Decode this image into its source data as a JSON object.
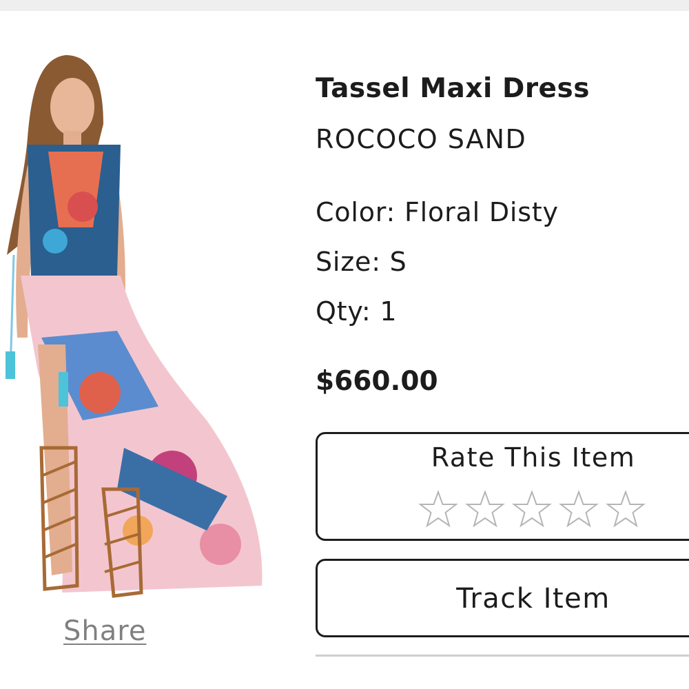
{
  "product": {
    "title": "Tassel Maxi Dress",
    "brand": "ROCOCO SAND",
    "color": "Color: Floral Disty",
    "size": "Size: S",
    "qty": "Qty: 1",
    "price": "$660.00",
    "image_icon": "product-photo"
  },
  "share": {
    "label": "Share"
  },
  "rating": {
    "label": "Rate This Item",
    "max_stars": 5,
    "current_rating": 0
  },
  "track": {
    "label": "Track Item"
  },
  "colors": {
    "text": "#1c1c1c",
    "share_link": "#808080",
    "divider": "#cfcfcf",
    "star_outline": "#b5b5b5"
  }
}
